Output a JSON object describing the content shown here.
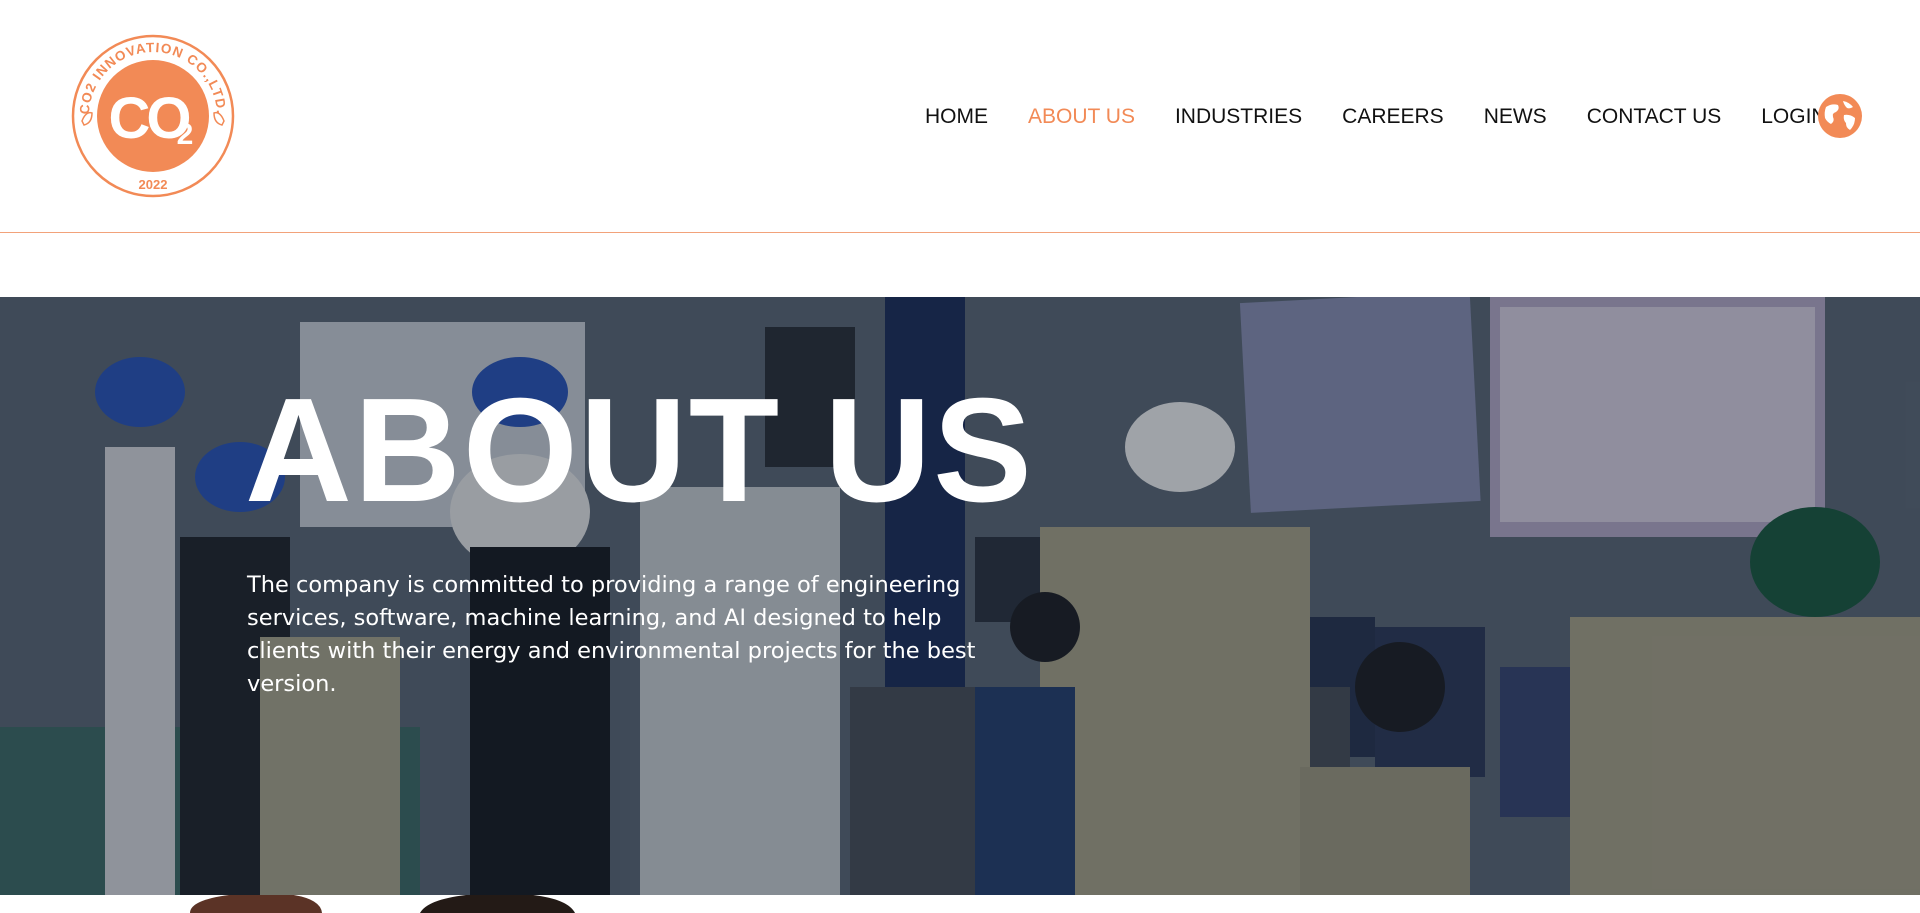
{
  "logo": {
    "ring_text": "CO2 INNOVATION CO.,LTD.",
    "main": "CO",
    "sub": "2",
    "year": "2022",
    "color": "#f28a56"
  },
  "nav": {
    "items": [
      {
        "label": "HOME"
      },
      {
        "label": "ABOUT US",
        "active": true
      },
      {
        "label": "INDUSTRIES"
      },
      {
        "label": "CAREERS"
      },
      {
        "label": "NEWS"
      },
      {
        "label": "CONTACT US"
      },
      {
        "label": "LOGIN"
      }
    ],
    "active_color": "#f28a56",
    "language_icon": "globe-icon"
  },
  "hero": {
    "title": "ABOUT US",
    "description": "The company is committed to providing a range of engineering services, software, machine learning, and AI designed to help clients with their energy and environmental projects for the best version."
  }
}
